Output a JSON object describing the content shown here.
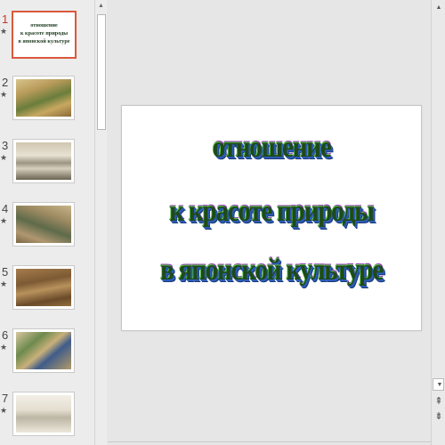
{
  "slides": [
    {
      "number": "1",
      "star": "★",
      "kind": "title",
      "mini_title_lines": [
        "отношение",
        "к красоте природы",
        "в японской культуре"
      ]
    },
    {
      "number": "2",
      "star": "★",
      "kind": "painting"
    },
    {
      "number": "3",
      "star": "★",
      "kind": "painting"
    },
    {
      "number": "4",
      "star": "★",
      "kind": "painting"
    },
    {
      "number": "5",
      "star": "★",
      "kind": "painting"
    },
    {
      "number": "6",
      "star": "★",
      "kind": "painting"
    },
    {
      "number": "7",
      "star": "★",
      "kind": "painting"
    }
  ],
  "selected_slide": "1",
  "current_slide": {
    "title_lines": [
      "отношение",
      "к красоте природы",
      "в японской культуре"
    ]
  },
  "scrollbar": {
    "up_arrow": "▲",
    "down_arrow": "▼",
    "prev_slide": "⇞",
    "next_slide": "⇟"
  },
  "colors": {
    "selection_border": "#d9593c",
    "title_fill": "#1e4a1a",
    "title_shadow_blue": "#2d5bb8"
  }
}
